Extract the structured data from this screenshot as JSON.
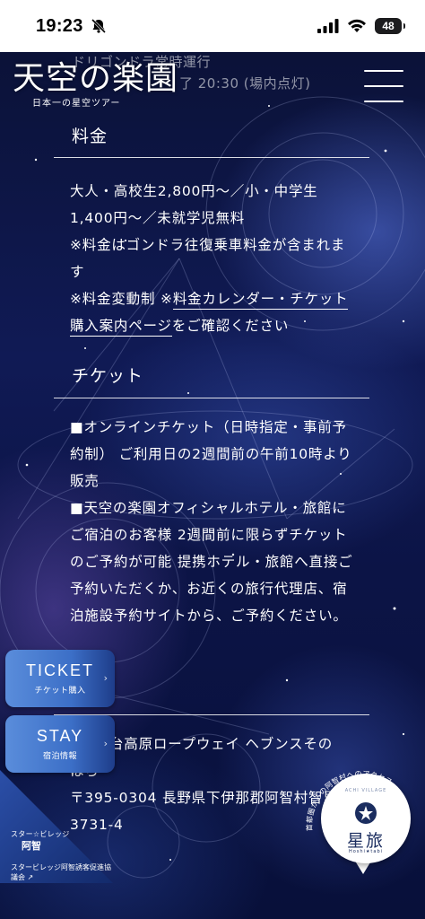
{
  "status_bar": {
    "time": "19:23",
    "battery": "48"
  },
  "header": {
    "ticker_line1": "ドリゴンドラ常時運行",
    "ticker_line2": "了 20:30 (場内点灯)",
    "logo_main": "天空の楽園",
    "logo_sub": "日本一の星空ツアー"
  },
  "fee_section": {
    "heading": "料金",
    "line1": "大人・高校生2,800円～／小・中学生1,400円～／未就学児無料",
    "line2": "※料金はゴンドラ往復乗車料金が含まれます",
    "line3_prefix": "※料金変動制 ※",
    "line3_link": "料金カレンダー・チケット購入案内ページ",
    "line3_suffix": "をご確認ください"
  },
  "ticket_section": {
    "heading": "チケット",
    "line1": "■オンラインチケット（日時指定・事前予約制） ご利用日の2週間前の午前10時より販売",
    "line2": "■天空の楽園オフィシャルホテル・旅館にご宿泊のお客様 2週間前に限らずチケットのご予約が可能 提携ホテル・旅館へ直接ご予約いただくか、お近くの旅行代理店、宿泊施設予約サイトから、ご予約ください。"
  },
  "address_section": {
    "line1": "台高原ロープウェイ ヘブンスその",
    "line1b": "はら",
    "line2": "〒395-0304 長野県下伊那郡阿智村智里3731-4"
  },
  "float_buttons": {
    "ticket_big": "TICKET",
    "ticket_small": "チケット購入",
    "stay_big": "STAY",
    "stay_small": "宿泊情報"
  },
  "corner_banner": {
    "line1": "スター☆ビレッジ",
    "line2": "阿智",
    "line3": "スタービレッジ阿智誘客促進協議会"
  },
  "hoshi_badge": {
    "arc_text": "首都圏からの阿智村へのアクセス",
    "top_text": "ACHI VILLAGE",
    "main": "星旅",
    "sub": "Hoshi★tabi"
  }
}
